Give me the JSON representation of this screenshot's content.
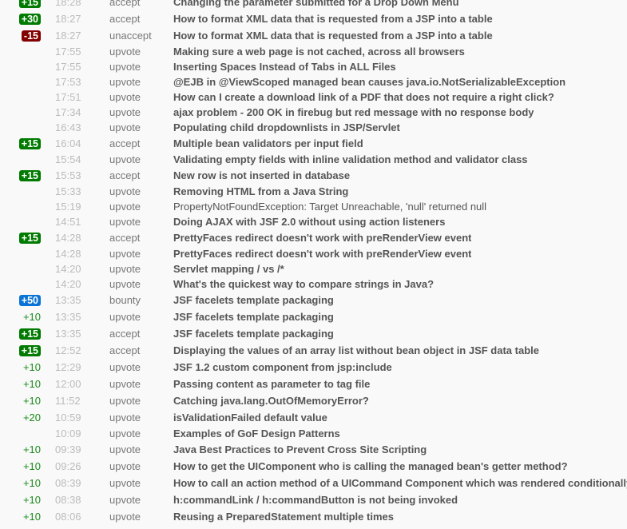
{
  "colors": {
    "accept_badge": "#007a00",
    "unaccept_badge": "#820000",
    "bounty_badge": "#0a74d6",
    "upvote_text": "#1a8a1a"
  },
  "rows": [
    {
      "amount": "+15",
      "style": "accept",
      "time": "18:28",
      "type": "accept",
      "title": "Changing the parameter submitted for a Drop Down Menu"
    },
    {
      "amount": "+30",
      "style": "accept",
      "time": "18:27",
      "type": "accept",
      "title": "How to format XML data that is requested from a JSP into a table"
    },
    {
      "amount": "-15",
      "style": "unaccept",
      "time": "18:27",
      "type": "unaccept",
      "title": "How to format XML data that is requested from a JSP into a table"
    },
    {
      "amount": "",
      "style": "none",
      "time": "17:55",
      "type": "upvote",
      "title": "Making sure a web page is not cached, across all browsers"
    },
    {
      "amount": "",
      "style": "none",
      "time": "17:55",
      "type": "upvote",
      "title": "Inserting Spaces Instead of Tabs in ALL Files"
    },
    {
      "amount": "",
      "style": "none",
      "time": "17:53",
      "type": "upvote",
      "title": "@EJB in @ViewScoped managed bean causes java.io.NotSerializableException"
    },
    {
      "amount": "",
      "style": "none",
      "time": "17:51",
      "type": "upvote",
      "title": "How can I create a download link of a PDF that does not require a right click?"
    },
    {
      "amount": "",
      "style": "none",
      "time": "17:34",
      "type": "upvote",
      "title": "ajax problem - 200 OK in firebug but red message with no response body"
    },
    {
      "amount": "",
      "style": "none",
      "time": "16:43",
      "type": "upvote",
      "title": "Populating child dropdownlists in JSP/Servlet"
    },
    {
      "amount": "+15",
      "style": "accept",
      "time": "16:04",
      "type": "accept",
      "title": "Multiple bean validators per input field"
    },
    {
      "amount": "",
      "style": "none",
      "time": "15:54",
      "type": "upvote",
      "title": "Validating empty fields with inline validation method and validator class"
    },
    {
      "amount": "+15",
      "style": "accept",
      "time": "15:53",
      "type": "accept",
      "title": "New row is not inserted in database"
    },
    {
      "amount": "",
      "style": "none",
      "time": "15:33",
      "type": "upvote",
      "title": "Removing HTML from a Java String"
    },
    {
      "amount": "",
      "style": "none",
      "time": "15:19",
      "type": "upvote",
      "title": "PropertyNotFoundException: Target Unreachable, 'null' returned null",
      "normal": true
    },
    {
      "amount": "",
      "style": "none",
      "time": "14:51",
      "type": "upvote",
      "title": "Doing AJAX with JSF 2.0 without using action listeners"
    },
    {
      "amount": "+15",
      "style": "accept",
      "time": "14:28",
      "type": "accept",
      "title": "PrettyFaces redirect doesn't work with preRenderView event"
    },
    {
      "amount": "",
      "style": "none",
      "time": "14:28",
      "type": "upvote",
      "title": "PrettyFaces redirect doesn't work with preRenderView event"
    },
    {
      "amount": "",
      "style": "none",
      "time": "14:20",
      "type": "upvote",
      "title": "Servlet mapping / vs /*"
    },
    {
      "amount": "",
      "style": "none",
      "time": "14:20",
      "type": "upvote",
      "title": "What's the quickest way to compare strings in Java?"
    },
    {
      "amount": "+50",
      "style": "bounty",
      "time": "13:35",
      "type": "bounty",
      "title": "JSF facelets template packaging"
    },
    {
      "amount": "+10",
      "style": "plain",
      "time": "13:35",
      "type": "upvote",
      "title": "JSF facelets template packaging"
    },
    {
      "amount": "+15",
      "style": "accept",
      "time": "13:35",
      "type": "accept",
      "title": "JSF facelets template packaging"
    },
    {
      "amount": "+15",
      "style": "accept",
      "time": "12:52",
      "type": "accept",
      "title": "Displaying the values of an array list without bean object in JSF data table"
    },
    {
      "amount": "+10",
      "style": "plain",
      "time": "12:29",
      "type": "upvote",
      "title": "JSF 1.2 custom component from jsp:include"
    },
    {
      "amount": "+10",
      "style": "plain",
      "time": "12:00",
      "type": "upvote",
      "title": "Passing content as parameter to tag file"
    },
    {
      "amount": "+10",
      "style": "plain",
      "time": "11:52",
      "type": "upvote",
      "title": "Catching java.lang.OutOfMemoryError?"
    },
    {
      "amount": "+20",
      "style": "plain",
      "time": "10:59",
      "type": "upvote",
      "title": "isValidationFailed default value"
    },
    {
      "amount": "",
      "style": "none",
      "time": "10:09",
      "type": "upvote",
      "title": "Examples of GoF Design Patterns"
    },
    {
      "amount": "+10",
      "style": "plain",
      "time": "09:39",
      "type": "upvote",
      "title": "Java Best Practices to Prevent Cross Site Scripting"
    },
    {
      "amount": "+10",
      "style": "plain",
      "time": "09:26",
      "type": "upvote",
      "title": "How to get the UIComponent who is calling the managed bean's getter method?"
    },
    {
      "amount": "+10",
      "style": "plain",
      "time": "08:39",
      "type": "upvote",
      "title": "How to call an action method of a UICommand Component which was rendered conditionally?"
    },
    {
      "amount": "+10",
      "style": "plain",
      "time": "08:38",
      "type": "upvote",
      "title": "h:commandLink / h:commandButton is not being invoked"
    },
    {
      "amount": "+10",
      "style": "plain",
      "time": "08:06",
      "type": "upvote",
      "title": "Reusing a PreparedStatement multiple times"
    }
  ]
}
